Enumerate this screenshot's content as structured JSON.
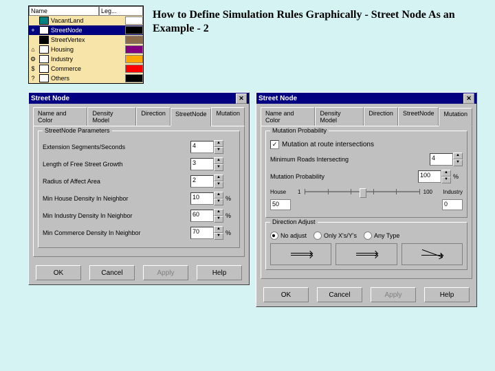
{
  "title": "How to Define Simulation Rules Graphically - Street Node As an Example - 2",
  "legend": {
    "headers": [
      "Name",
      "Leg..."
    ],
    "rows": [
      {
        "mark": "",
        "swatch": "#008080",
        "name": "VacantLand",
        "c2": "#ffffff"
      },
      {
        "mark": "+",
        "swatch": "#ffffff",
        "name": "StreetNode",
        "c2": "#000000",
        "selected": true
      },
      {
        "mark": "",
        "swatch": "#000000",
        "name": "StreetVertex",
        "c2": "#8b6b4a"
      },
      {
        "mark": "⌂",
        "swatch": "#ffffff",
        "name": "Housing",
        "c2": "#800080"
      },
      {
        "mark": "⚙",
        "swatch": "#ffffff",
        "name": "Industry",
        "c2": "#ffa500"
      },
      {
        "mark": "$",
        "swatch": "#ffffff",
        "name": "Commerce",
        "c2": "#ff0000"
      },
      {
        "mark": "?",
        "swatch": "#ffffff",
        "name": "Others",
        "c2": "#000000"
      }
    ]
  },
  "dialogLeft": {
    "title": "Street Node",
    "tabs": [
      "Name and Color",
      "Density Model",
      "Direction",
      "StreetNode",
      "Mutation"
    ],
    "activeTab": 3,
    "group": "StreetNode Parameters",
    "fields": [
      {
        "label": "Extension Segments/Seconds",
        "value": "4",
        "unit": ""
      },
      {
        "label": "Length of Free Street Growth",
        "value": "3",
        "unit": ""
      },
      {
        "label": "Radius of Affect Area",
        "value": "2",
        "unit": ""
      },
      {
        "label": "Min House Density In Neighbor",
        "value": "10",
        "unit": "%"
      },
      {
        "label": "Min Industry Density In Neighbor",
        "value": "60",
        "unit": "%"
      },
      {
        "label": "Min Commerce Density In Neighbor",
        "value": "70",
        "unit": "%"
      }
    ],
    "buttons": [
      "OK",
      "Cancel",
      "Apply",
      "Help"
    ]
  },
  "dialogRight": {
    "title": "Street Node",
    "tabs": [
      "Name and Color",
      "Density Model",
      "Direction",
      "StreetNode",
      "Mutation"
    ],
    "activeTab": 4,
    "group1": "Mutation Probability",
    "chkLabel": "Mutation at route intersections",
    "chkChecked": true,
    "f1": {
      "label": "Minimum Roads Intersecting",
      "value": "4"
    },
    "f2": {
      "label": "Mutation Probability",
      "value": "100",
      "unit": "%"
    },
    "sliderLabels": {
      "left": "House",
      "right": "Industry",
      "minTick": "1",
      "maxTick": "100"
    },
    "sliderVals": {
      "left": "50",
      "right": "0"
    },
    "group2": "Direction Adjust",
    "radios": [
      {
        "label": "No adjust",
        "checked": true
      },
      {
        "label": "Only X's/Y's",
        "checked": false
      },
      {
        "label": "Any Type",
        "checked": false
      }
    ],
    "buttons": [
      "OK",
      "Cancel",
      "Apply",
      "Help"
    ]
  }
}
